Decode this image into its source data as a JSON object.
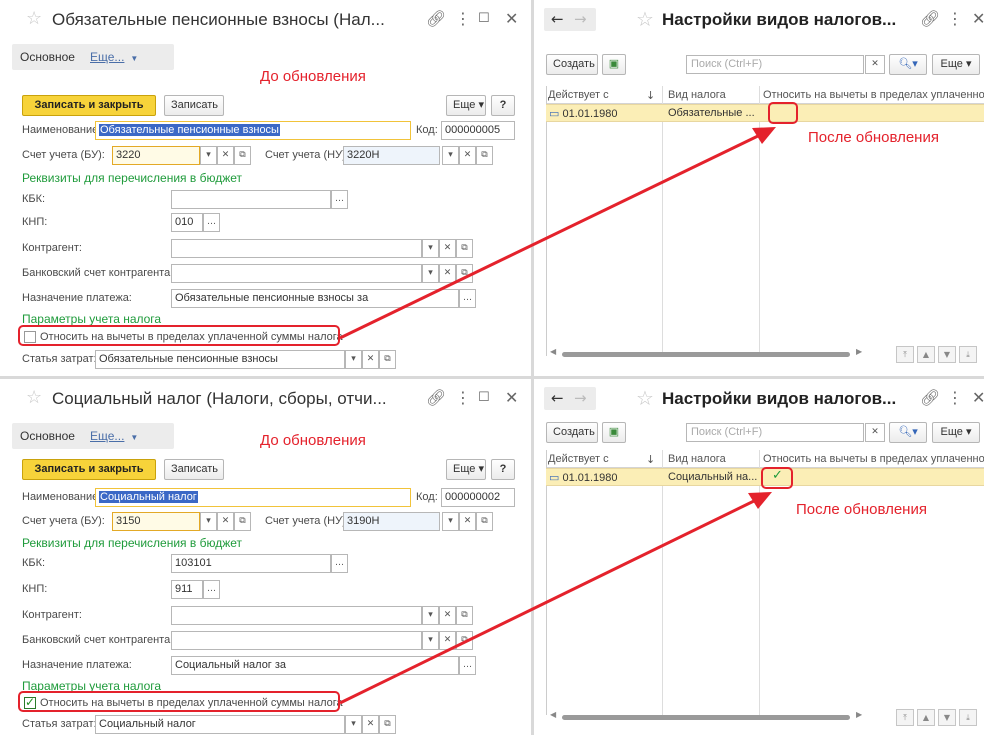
{
  "colors": {
    "accent_red": "#e4222c",
    "green_section": "#1f9b3b",
    "primary_button": "#f7d33a",
    "row_highlight": "#fbeeb6"
  },
  "forms": [
    {
      "title": "Обязательные пенсионные взносы (Нал...",
      "tab_main": "Основное",
      "tab_more": "Еще...",
      "annotation": "До обновления",
      "save_close": "Записать и закрыть",
      "save": "Записать",
      "more": "Еще",
      "help": "?",
      "name_label": "Наименование:",
      "name_value": "Обязательные пенсионные взносы",
      "code_label": "Код:",
      "code_value": "000000005",
      "acc_bu_label": "Счет учета (БУ):",
      "acc_bu_value": "3220",
      "acc_nu_label": "Счет учета (НУ):",
      "acc_nu_value": "3220Н",
      "section_budget": "Реквизиты для перечисления в бюджет",
      "kbk_label": "КБК:",
      "kbk_value": "",
      "knp_label": "КНП:",
      "knp_value": "010",
      "contractor_label": "Контрагент:",
      "bank_label": "Банковский счет контрагента:",
      "purpose_label": "Назначение платежа:",
      "purpose_value": "Обязательные пенсионные взносы за",
      "section_tax": "Параметры учета налога",
      "deduct_label": "Относить на вычеты в пределах уплаченной суммы налога",
      "deduct_checked": false,
      "expense_label": "Статья затрат:",
      "expense_value": "Обязательные пенсионные взносы"
    },
    {
      "title": "Социальный налог (Налоги, сборы, отчи...",
      "tab_main": "Основное",
      "tab_more": "Еще...",
      "annotation": "До обновления",
      "save_close": "Записать и закрыть",
      "save": "Записать",
      "more": "Еще",
      "help": "?",
      "name_label": "Наименование:",
      "name_value": "Социальный налог",
      "code_label": "Код:",
      "code_value": "000000002",
      "acc_bu_label": "Счет учета (БУ):",
      "acc_bu_value": "3150",
      "acc_nu_label": "Счет учета (НУ):",
      "acc_nu_value": "3190Н",
      "section_budget": "Реквизиты для перечисления в бюджет",
      "kbk_label": "КБК:",
      "kbk_value": "103101",
      "knp_label": "КНП:",
      "knp_value": "911",
      "contractor_label": "Контрагент:",
      "bank_label": "Банковский счет контрагента:",
      "purpose_label": "Назначение платежа:",
      "purpose_value": "Социальный налог за",
      "section_tax": "Параметры учета налога",
      "deduct_label": "Относить на вычеты в пределах уплаченной суммы налога",
      "deduct_checked": true,
      "expense_label": "Статья затрат:",
      "expense_value": "Социальный налог"
    }
  ],
  "lists": [
    {
      "title": "Настройки видов налогов...",
      "create": "Создать",
      "search_placeholder": "Поиск (Ctrl+F)",
      "more": "Еще",
      "col_date": "Действует с",
      "col_tax": "Вид налога",
      "col_deduct": "Относить на вычеты в пределах уплаченной",
      "row_date": "01.01.1980",
      "row_tax": "Обязательные ...",
      "row_checked": false,
      "annotation": "После обновления"
    },
    {
      "title": "Настройки видов налогов...",
      "create": "Создать",
      "search_placeholder": "Поиск (Ctrl+F)",
      "more": "Еще",
      "col_date": "Действует с",
      "col_tax": "Вид налога",
      "col_deduct": "Относить на вычеты в пределах уплаченной",
      "row_date": "01.01.1980",
      "row_tax": "Социальный на...",
      "row_checked": true,
      "annotation": "После обновления"
    }
  ]
}
